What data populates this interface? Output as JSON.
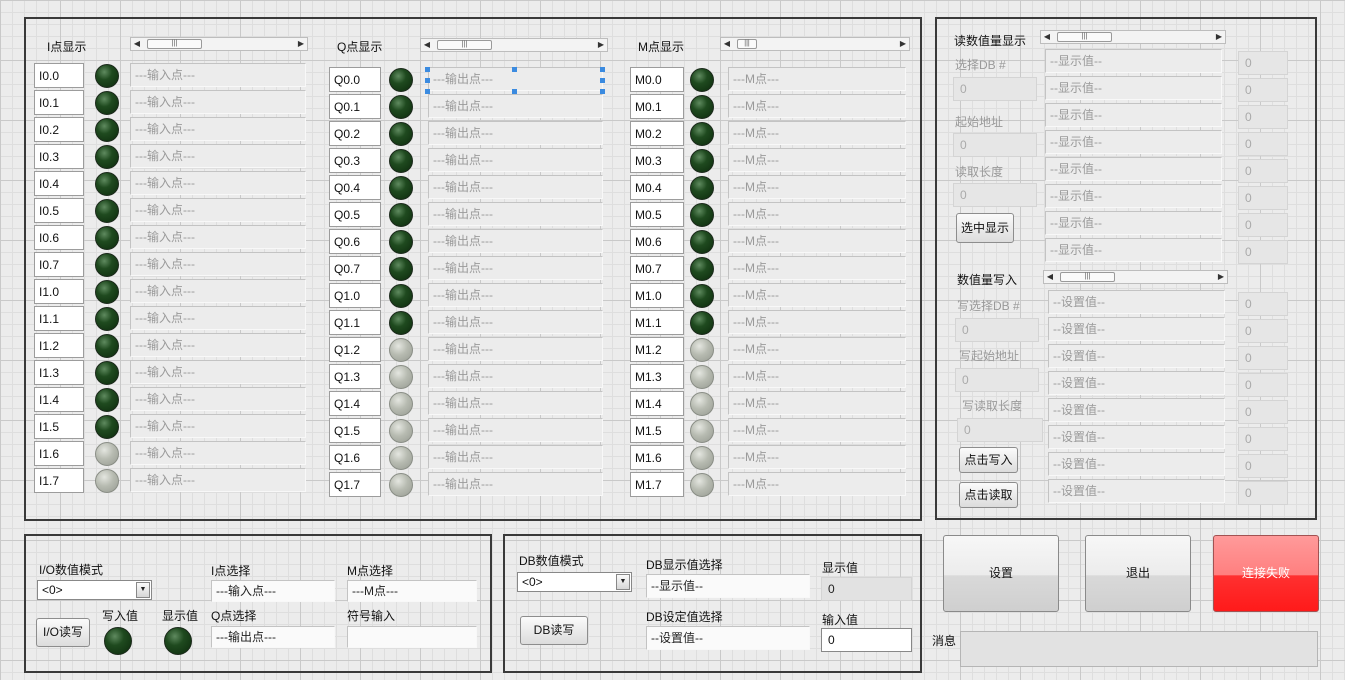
{
  "io_panel": {
    "i": {
      "title": "I点显示",
      "points": [
        "I0.0",
        "I0.1",
        "I0.2",
        "I0.3",
        "I0.4",
        "I0.5",
        "I0.6",
        "I0.7",
        "I1.0",
        "I1.1",
        "I1.2",
        "I1.3",
        "I1.4",
        "I1.5",
        "I1.6",
        "I1.7"
      ],
      "states": [
        true,
        true,
        true,
        true,
        true,
        true,
        true,
        true,
        true,
        true,
        true,
        true,
        true,
        true,
        false,
        false
      ],
      "desc": "---输入点---"
    },
    "q": {
      "title": "Q点显示",
      "points": [
        "Q0.0",
        "Q0.1",
        "Q0.2",
        "Q0.3",
        "Q0.4",
        "Q0.5",
        "Q0.6",
        "Q0.7",
        "Q1.0",
        "Q1.1",
        "Q1.2",
        "Q1.3",
        "Q1.4",
        "Q1.5",
        "Q1.6",
        "Q1.7"
      ],
      "states": [
        true,
        true,
        true,
        true,
        true,
        true,
        true,
        true,
        true,
        true,
        false,
        false,
        false,
        false,
        false,
        false
      ],
      "desc": "---输出点---"
    },
    "m": {
      "title": "M点显示",
      "points": [
        "M0.0",
        "M0.1",
        "M0.2",
        "M0.3",
        "M0.4",
        "M0.5",
        "M0.6",
        "M0.7",
        "M1.0",
        "M1.1",
        "M1.2",
        "M1.3",
        "M1.4",
        "M1.5",
        "M1.6",
        "M1.7"
      ],
      "states": [
        true,
        true,
        true,
        true,
        true,
        true,
        true,
        true,
        true,
        true,
        false,
        false,
        false,
        false,
        false,
        false
      ],
      "desc": "---M点---"
    }
  },
  "read_panel": {
    "title": "读数值量显示",
    "select_db_label": "选择DB #",
    "select_db_value": "0",
    "start_addr_label": "起始地址",
    "start_addr_value": "0",
    "length_label": "读取长度",
    "length_value": "0",
    "show_button": "选中显示",
    "rows": [
      {
        "text": "--显示值--",
        "value": "0"
      },
      {
        "text": "--显示值--",
        "value": "0"
      },
      {
        "text": "--显示值--",
        "value": "0"
      },
      {
        "text": "--显示值--",
        "value": "0"
      },
      {
        "text": "--显示值--",
        "value": "0"
      },
      {
        "text": "--显示值--",
        "value": "0"
      },
      {
        "text": "--显示值--",
        "value": "0"
      },
      {
        "text": "--显示值--",
        "value": "0"
      }
    ]
  },
  "write_panel": {
    "title": "数值量写入",
    "select_db_label": "写选择DB #",
    "select_db_value": "0",
    "start_addr_label": "写起始地址",
    "start_addr_value": "0",
    "length_label": "写读取长度",
    "length_value": "0",
    "write_button": "点击写入",
    "read_button": "点击读取",
    "rows": [
      {
        "text": "--设置值--",
        "value": "0"
      },
      {
        "text": "--设置值--",
        "value": "0"
      },
      {
        "text": "--设置值--",
        "value": "0"
      },
      {
        "text": "--设置值--",
        "value": "0"
      },
      {
        "text": "--设置值--",
        "value": "0"
      },
      {
        "text": "--设置值--",
        "value": "0"
      },
      {
        "text": "--设置值--",
        "value": "0"
      },
      {
        "text": "--设置值--",
        "value": "0"
      }
    ]
  },
  "io_mode_panel": {
    "mode_label": "I/O数值模式",
    "mode_value": "<0>",
    "i_select_label": "I点选择",
    "i_select_value": "---输入点---",
    "m_select_label": "M点选择",
    "m_select_value": "---M点---",
    "write_label": "写入值",
    "display_label": "显示值",
    "q_select_label": "Q点选择",
    "q_select_value": "---输出点---",
    "symbol_label": "符号输入",
    "symbol_value": "",
    "rw_button": "I/O读写"
  },
  "db_mode_panel": {
    "mode_label": "DB数值模式",
    "mode_value": "<0>",
    "display_select_label": "DB显示值选择",
    "display_select_value": "--显示值--",
    "display_value_label": "显示值",
    "display_value": "0",
    "set_select_label": "DB设定值选择",
    "set_select_value": "--设置值--",
    "input_value_label": "输入值",
    "input_value": "0",
    "rw_button": "DB读写"
  },
  "actions": {
    "settings": "设置",
    "exit": "退出",
    "connection": "连接失败"
  },
  "message": {
    "label": "消息",
    "value": ""
  }
}
